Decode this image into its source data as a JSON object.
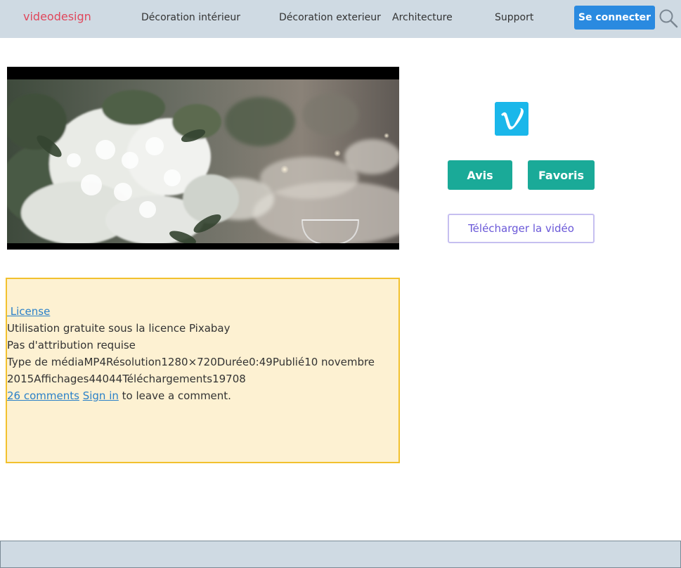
{
  "header": {
    "logo": "videodesign",
    "nav": [
      "Décoration intérieur",
      "Décoration exterieur",
      "Architecture",
      "Support"
    ],
    "login_label": "Se connecter"
  },
  "sidebar": {
    "avis_label": "Avis",
    "favoris_label": "Favoris",
    "download_label": "Télécharger la vidéo"
  },
  "info": {
    "license_link": "License",
    "license_text": "Utilisation gratuite sous la licence Pixabay",
    "attribution": "Pas d'attribution requise",
    "media_type_label": "Type de média",
    "media_type": "MP4",
    "resolution_label": "Résolution",
    "resolution": "1280×720",
    "duration_label": "Durée",
    "duration": "0:49",
    "published_label": "Publié",
    "published": "10 novembre 2015",
    "views_label": "Affichages",
    "views": "44044",
    "downloads_label": "Téléchargements",
    "downloads": "19708",
    "comments_link": "26 comments",
    "signin_link": "Sign in",
    "comment_suffix": " to leave a comment."
  },
  "colors": {
    "nav_bg": "#cfdae3",
    "logo": "#e0475c",
    "login_button": "#2a8ae0",
    "action_button": "#1aaa98",
    "download_text": "#6a58d8",
    "info_bg": "#fdf1d2",
    "info_border": "#f2c12e",
    "vimeo": "#1ab7ea"
  }
}
